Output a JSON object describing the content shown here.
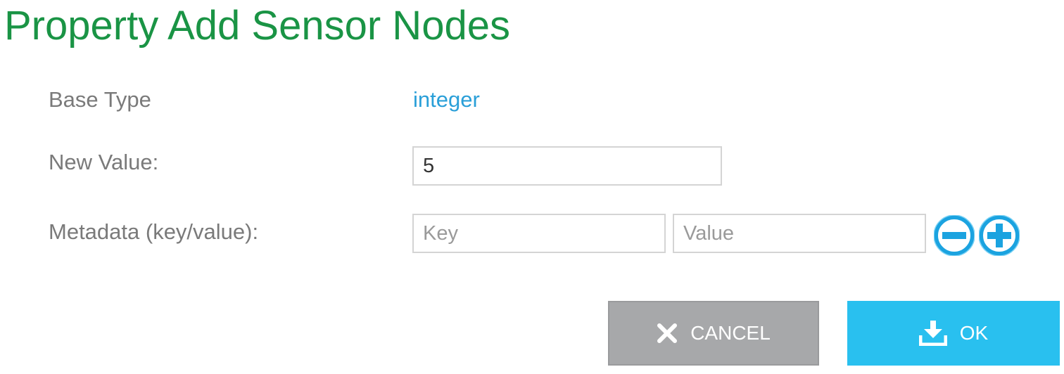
{
  "dialog": {
    "title": "Property Add Sensor Nodes"
  },
  "form": {
    "base_type_label": "Base Type",
    "base_type_value": "integer",
    "new_value_label": "New Value:",
    "new_value": "5",
    "metadata_label": "Metadata (key/value):",
    "key_placeholder": "Key",
    "value_placeholder": "Value"
  },
  "icons": {
    "remove": "minus-circle-icon",
    "add": "plus-circle-icon",
    "cancel": "close-icon",
    "ok": "download-icon"
  },
  "buttons": {
    "cancel_label": "CANCEL",
    "ok_label": "OK"
  },
  "colors": {
    "title": "#1a9445",
    "link": "#2a9fd8",
    "ok_button": "#29c0ef",
    "cancel_button": "#a7a8aa",
    "icon_blue": "#1ba3e0"
  }
}
